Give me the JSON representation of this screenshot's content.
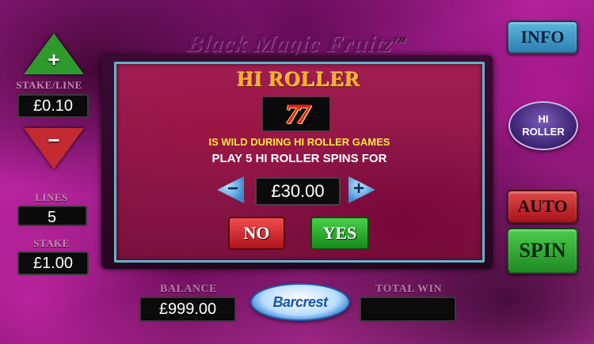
{
  "logo": {
    "text": "Black Magic Fruitz",
    "tm": "TM"
  },
  "stake_line": {
    "label": "STAKE/LINE",
    "value": "£0.10",
    "increase": "+",
    "decrease": "−"
  },
  "lines": {
    "label": "LINES",
    "value": "5"
  },
  "stake": {
    "label": "STAKE",
    "value": "£1.00"
  },
  "buttons": {
    "info": "INFO",
    "hi_roller": [
      "HI",
      "ROLLER"
    ],
    "auto": "AUTO",
    "spin": "SPIN"
  },
  "dialog": {
    "title": "HI ROLLER",
    "symbol": "77",
    "wild_text": "IS WILD DURING HI ROLLER GAMES",
    "play_text": "PLAY 5 HI ROLLER SPINS FOR",
    "price": "£30.00",
    "minus": "−",
    "plus": "+",
    "no": "NO",
    "yes": "YES"
  },
  "balance": {
    "label": "BALANCE",
    "value": "£999.00"
  },
  "total_win": {
    "label": "TOTAL WIN",
    "value": ""
  },
  "brand": "Barcrest",
  "colors": {
    "panel_border": "#5fb6c8",
    "title": "#ffb020",
    "wild_text": "#ffe83a",
    "yes": "#2ea82e",
    "no": "#d42a30"
  }
}
